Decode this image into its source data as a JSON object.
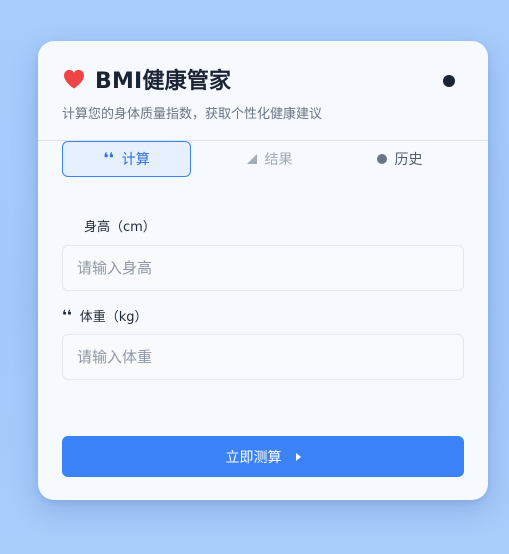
{
  "app": {
    "title": "BMI健康管家",
    "subtitle": "计算您的身体质量指数，获取个性化健康建议"
  },
  "tabs": [
    {
      "label": "计算",
      "icon": "quote-icon",
      "active": true
    },
    {
      "label": "结果",
      "icon": "ruler-icon",
      "active": false
    },
    {
      "label": "历史",
      "icon": "history-icon",
      "active": false
    }
  ],
  "form": {
    "height_label": "身高（cm）",
    "height_placeholder": "请输入身高",
    "weight_icon_glyph": "❛❛",
    "weight_label": "体重（kg）",
    "weight_placeholder": "请输入体重",
    "submit_label": "立即测算"
  },
  "icon_glyphs": {
    "quote": "❛❛"
  },
  "colors": {
    "accent": "#3b82f6",
    "heart": "#ef4444",
    "page_bg": "#a8cdfc",
    "card_bg": "#f6f9fd",
    "title_text": "#1b2435"
  }
}
